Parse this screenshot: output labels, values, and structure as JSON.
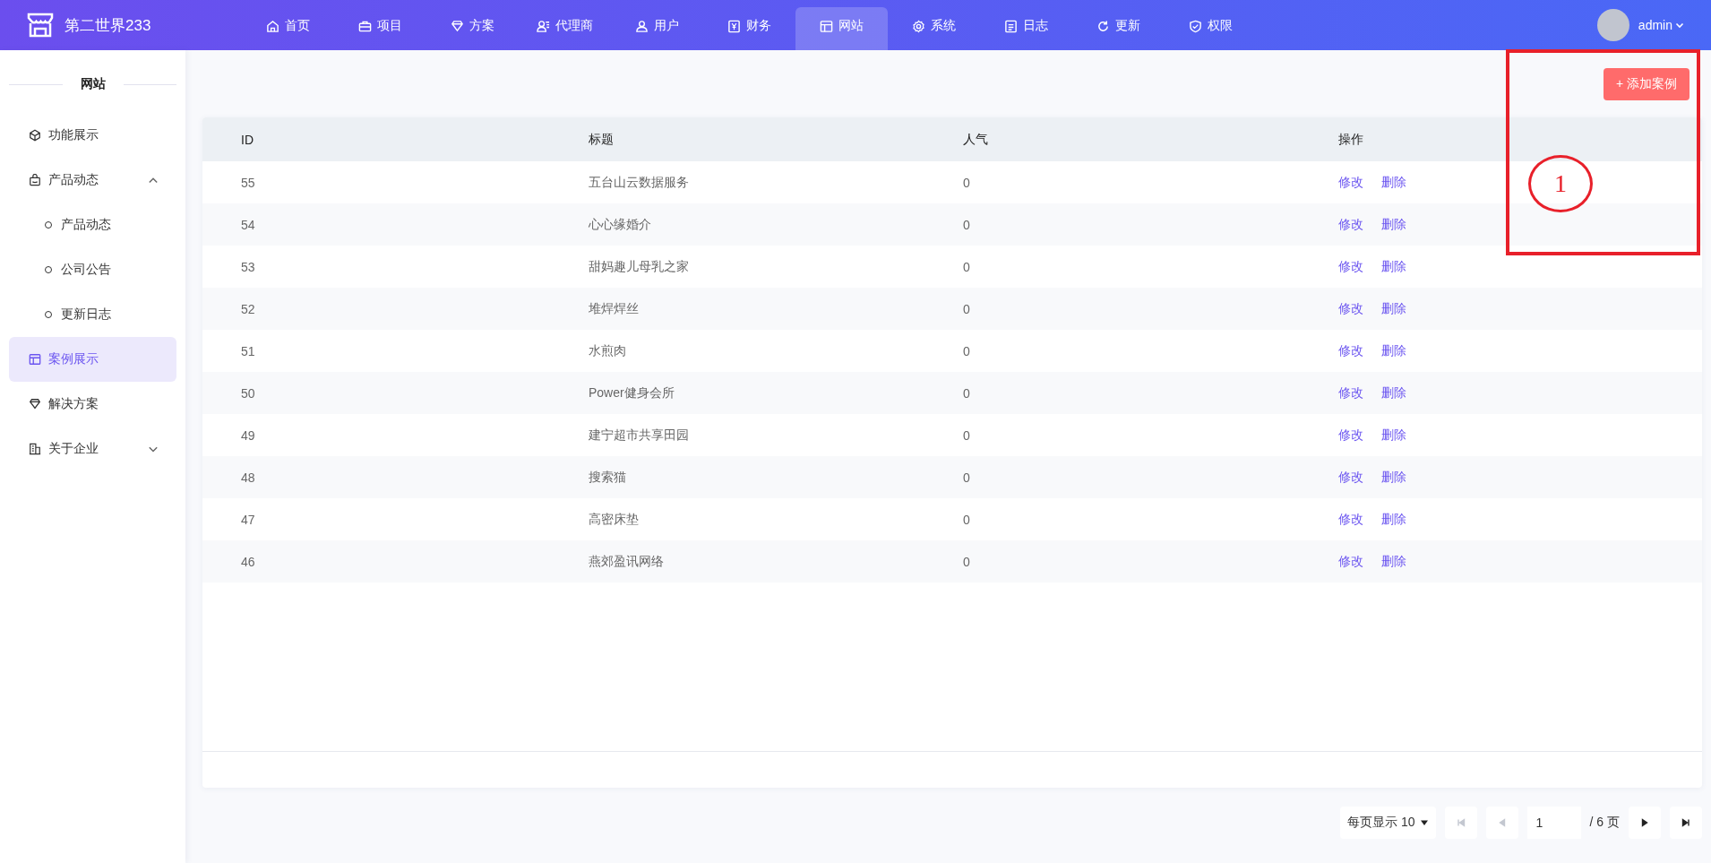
{
  "brand": {
    "name": "第二世界233"
  },
  "nav": [
    {
      "label": "首页",
      "kind": "home",
      "selected": false
    },
    {
      "label": "项目",
      "kind": "briefcase",
      "selected": false
    },
    {
      "label": "方案",
      "kind": "diamond",
      "selected": false
    },
    {
      "label": "代理商",
      "kind": "agent",
      "selected": false
    },
    {
      "label": "用户",
      "kind": "users",
      "selected": false
    },
    {
      "label": "财务",
      "kind": "money",
      "selected": false
    },
    {
      "label": "网站",
      "kind": "layout",
      "selected": true
    },
    {
      "label": "系统",
      "kind": "gear",
      "selected": false
    },
    {
      "label": "日志",
      "kind": "doc",
      "selected": false
    },
    {
      "label": "更新",
      "kind": "refresh",
      "selected": false
    },
    {
      "label": "权限",
      "kind": "shield",
      "selected": false
    }
  ],
  "user": {
    "name": "admin"
  },
  "sidebar": {
    "title": "网站",
    "items": [
      {
        "label": "功能展示",
        "kind": "cube",
        "selected": false
      },
      {
        "label": "产品动态",
        "kind": "bag",
        "selected": false,
        "expanded": true,
        "children": [
          {
            "label": "产品动态",
            "selected": false
          },
          {
            "label": "公司公告",
            "selected": false
          },
          {
            "label": "更新日志",
            "selected": false
          }
        ]
      },
      {
        "label": "案例展示",
        "kind": "layout",
        "selected": true
      },
      {
        "label": "解决方案",
        "kind": "diamond",
        "selected": false
      },
      {
        "label": "关于企业",
        "kind": "building",
        "selected": false,
        "expanded": false
      }
    ]
  },
  "toolbar": {
    "add_button": "+ 添加案例"
  },
  "table": {
    "columns": [
      "ID",
      "标题",
      "人气",
      "操作"
    ],
    "rows": [
      {
        "id": "55",
        "title": "五台山云数据服务",
        "popularity": "0",
        "actions": [
          "修改",
          "删除"
        ]
      },
      {
        "id": "54",
        "title": "心心缘婚介",
        "popularity": "0",
        "actions": [
          "修改",
          "删除"
        ]
      },
      {
        "id": "53",
        "title": "甜妈趣儿母乳之家",
        "popularity": "0",
        "actions": [
          "修改",
          "删除"
        ]
      },
      {
        "id": "52",
        "title": "堆焊焊丝",
        "popularity": "0",
        "actions": [
          "修改",
          "删除"
        ]
      },
      {
        "id": "51",
        "title": "水煎肉",
        "popularity": "0",
        "actions": [
          "修改",
          "删除"
        ]
      },
      {
        "id": "50",
        "title": "Power健身会所",
        "popularity": "0",
        "actions": [
          "修改",
          "删除"
        ]
      },
      {
        "id": "49",
        "title": "建宁超市共享田园",
        "popularity": "0",
        "actions": [
          "修改",
          "删除"
        ]
      },
      {
        "id": "48",
        "title": "搜索猫",
        "popularity": "0",
        "actions": [
          "修改",
          "删除"
        ]
      },
      {
        "id": "47",
        "title": "高密床垫",
        "popularity": "0",
        "actions": [
          "修改",
          "删除"
        ]
      },
      {
        "id": "46",
        "title": "燕郊盈讯网络",
        "popularity": "0",
        "actions": [
          "修改",
          "删除"
        ]
      }
    ]
  },
  "pagination": {
    "page_size": "每页显示 10",
    "page": "1",
    "total": "/ 6 页",
    "buttons": [
      {
        "kind": "first",
        "disabled": true
      },
      {
        "kind": "prev",
        "disabled": true
      },
      {
        "kind": "next",
        "disabled": false
      },
      {
        "kind": "last",
        "disabled": false
      }
    ]
  },
  "annotation": {
    "label": "1"
  }
}
